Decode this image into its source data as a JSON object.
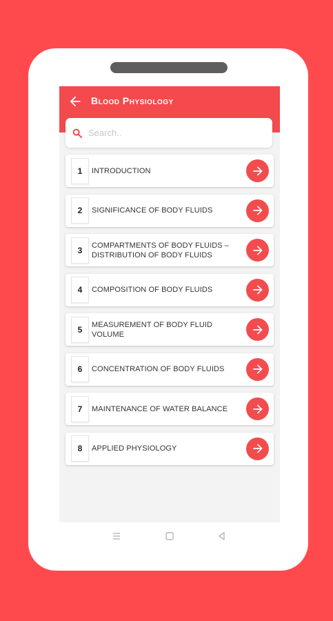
{
  "header": {
    "title": "Blood Physiology"
  },
  "search": {
    "placeholder": "Search.."
  },
  "chapters": [
    {
      "number": "1",
      "title": "INTRODUCTION"
    },
    {
      "number": "2",
      "title": "SIGNIFICANCE OF BODY FLUIDS"
    },
    {
      "number": "3",
      "title": "COMPARTMENTS OF BODY FLUIDS –DISTRIBUTION OF BODY FLUIDS"
    },
    {
      "number": "4",
      "title": "COMPOSITION OF BODY FLUIDS"
    },
    {
      "number": "5",
      "title": "MEASUREMENT OF BODY FLUID VOLUME"
    },
    {
      "number": "6",
      "title": "CONCENTRATION OF BODY FLUIDS"
    },
    {
      "number": "7",
      "title": "MAINTENANCE OF WATER BALANCE"
    },
    {
      "number": "8",
      "title": "APPLIED PHYSIOLOGY"
    }
  ],
  "icons": {
    "back": "arrow-left-icon",
    "search": "search-icon",
    "go": "arrow-right-icon",
    "nav_menu": "menu-icon",
    "nav_home": "home-icon",
    "nav_back": "back-triangle-icon"
  },
  "colors": {
    "accent": "#f44a4d",
    "background": "#ff4a4d"
  }
}
